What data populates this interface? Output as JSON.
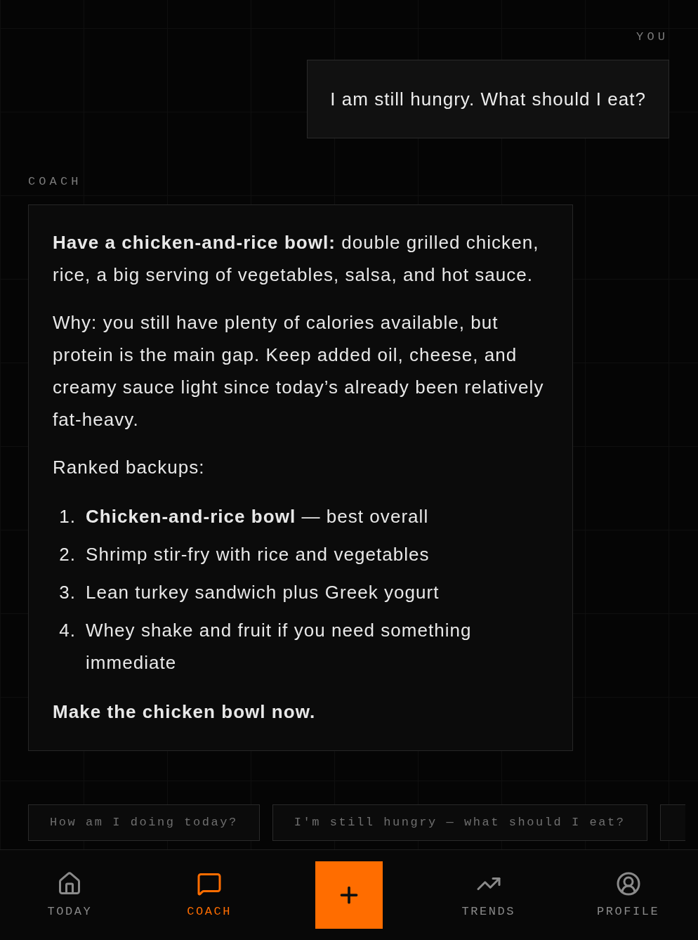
{
  "user_message": {
    "label": "YOU",
    "text": "I am still hungry. What should I eat?"
  },
  "coach_message": {
    "label": "COACH",
    "blocks": [
      {
        "kind": "paragraph",
        "text": "**Have a chicken-and-rice bowl:** double grilled chicken, rice, a big serving of vegetables, salsa, and hot sauce."
      },
      {
        "kind": "paragraph",
        "text": "Why: you still have plenty of calories available, but protein is the main gap. Keep added oil, cheese, and creamy sauce light since today’s already been relatively fat-heavy."
      },
      {
        "kind": "paragraph",
        "text": "Ranked backups:"
      },
      {
        "kind": "list",
        "items": [
          {
            "number": "1.",
            "text": "**Chicken-and-rice bowl** — best overall"
          },
          {
            "number": "2.",
            "text": "Shrimp stir-fry with rice and vegetables"
          },
          {
            "number": "3.",
            "text": "Lean turkey sandwich plus Greek yogurt"
          },
          {
            "number": "4.",
            "text": "Whey shake and fruit if you need something immediate"
          }
        ]
      },
      {
        "kind": "strong",
        "text": "Make the chicken bowl now."
      }
    ]
  },
  "suggestions": [
    "How am I doing today?",
    "I'm still hungry — what should I eat?"
  ],
  "bottom_nav": {
    "items": [
      {
        "kind": "tab",
        "label": "TODAY",
        "selected": false
      },
      {
        "kind": "tab",
        "label": "COACH",
        "selected": true
      },
      {
        "kind": "action"
      },
      {
        "kind": "tab",
        "label": "TRENDS",
        "selected": false
      },
      {
        "kind": "tab",
        "label": "PROFILE",
        "selected": false
      }
    ]
  }
}
